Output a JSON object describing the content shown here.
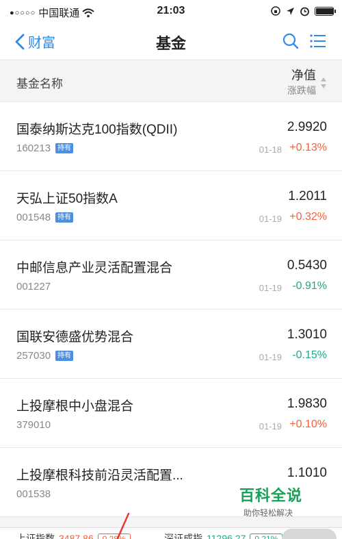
{
  "status_bar": {
    "signal": "●○○○○",
    "carrier": "中国联通",
    "time": "21:03"
  },
  "nav": {
    "back_label": "财富",
    "title": "基金"
  },
  "table_header": {
    "name": "基金名称",
    "nav": "净值",
    "change": "涨跌幅"
  },
  "funds": [
    {
      "name": "国泰纳斯达克100指数(QDII)",
      "code": "160213",
      "badge": "持有",
      "nav": "2.9920",
      "date": "01-18",
      "change": "+0.13%",
      "direction": "up"
    },
    {
      "name": "天弘上证50指数A",
      "code": "001548",
      "badge": "持有",
      "nav": "1.2011",
      "date": "01-19",
      "change": "+0.32%",
      "direction": "up"
    },
    {
      "name": "中邮信息产业灵活配置混合",
      "code": "001227",
      "badge": "",
      "nav": "0.5430",
      "date": "01-19",
      "change": "-0.91%",
      "direction": "down"
    },
    {
      "name": "国联安德盛优势混合",
      "code": "257030",
      "badge": "持有",
      "nav": "1.3010",
      "date": "01-19",
      "change": "-0.15%",
      "direction": "down"
    },
    {
      "name": "上投摩根中小盘混合",
      "code": "379010",
      "badge": "",
      "nav": "1.9830",
      "date": "01-19",
      "change": "+0.10%",
      "direction": "up"
    },
    {
      "name": "上投摩根科技前沿灵活配置...",
      "code": "001538",
      "badge": "",
      "nav": "1.1010",
      "date": "",
      "change": "",
      "direction": "up"
    }
  ],
  "index_bar": [
    {
      "name": "上证指数",
      "value": "3487.86",
      "change": "0.28%"
    },
    {
      "name": "深证成指",
      "value": "11296.27",
      "change": "0.21%"
    }
  ],
  "watermark": {
    "logo": "百科全说",
    "sub": "助你轻松解决"
  },
  "colors": {
    "accent": "#2f8ae6",
    "up": "#f0623a",
    "down": "#1fa78a",
    "badge": "#4b8fe0"
  }
}
